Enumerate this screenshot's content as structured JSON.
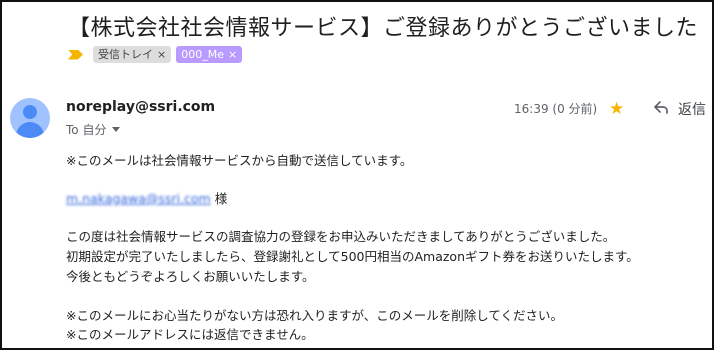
{
  "subject": "【株式会社社会情報サービス】ご登録ありがとうございました",
  "labels": {
    "inbox": "受信トレイ",
    "custom": "000_Me",
    "remove": "×"
  },
  "sender": {
    "email": "noreplay@ssri.com",
    "recipient_label": "To 自分"
  },
  "meta": {
    "timestamp": "16:39 (0 分前)",
    "reply_label": "返信"
  },
  "body": {
    "line1": "※このメールは社会情報サービスから自動で送信しています。",
    "address": "m.nakagawa@ssri.com",
    "address_suffix": "様",
    "para1": "この度は社会情報サービスの調査協力の登録をお申込みいただきましてありがとうございました。",
    "para2": "初期設定が完了いたしましたら、登録謝礼として500円相当のAmazonギフト券をお送りいたします。",
    "para3": "今後ともどうぞよろしくお願いいたします。",
    "note1": "※このメールにお心当たりがない方は恐れ入りますが、このメールを削除してください。",
    "note2": "※このメールアドレスには返信できません。"
  },
  "colors": {
    "importance": "#f4b400",
    "custom_label": "#b99aff",
    "avatar": "#a0c3ff",
    "link": "#1a0dab"
  },
  "icons": [
    "importance-marker-icon",
    "close-icon",
    "avatar-person-icon",
    "chevron-down-icon",
    "star-icon",
    "reply-icon"
  ]
}
